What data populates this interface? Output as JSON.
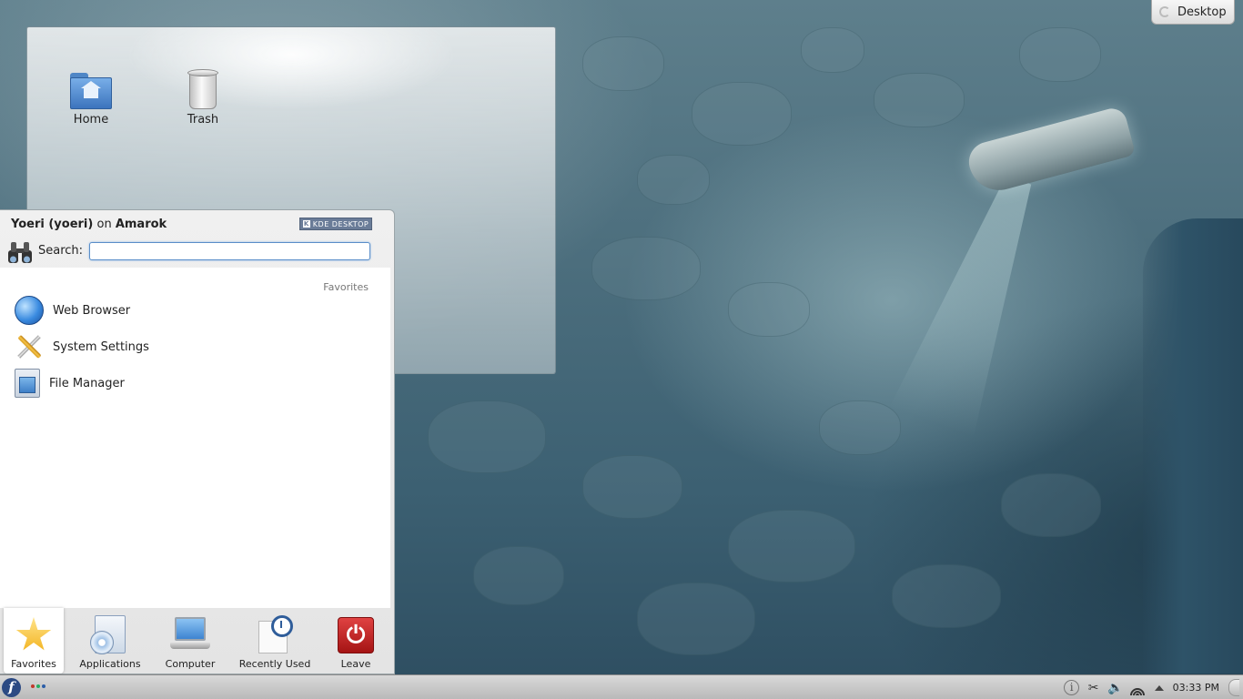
{
  "toolbox": {
    "label": "Desktop"
  },
  "desktop_icons": [
    {
      "label": "Home"
    },
    {
      "label": "Trash"
    }
  ],
  "kickoff": {
    "user": "Yoeri (yoeri)",
    "on": "on",
    "host": "Amarok",
    "badge": "KDE DESKTOP",
    "search_label": "Search:",
    "search_value": "",
    "section_title": "Favorites",
    "favorites": [
      {
        "label": "Web Browser",
        "icon": "globe-icon"
      },
      {
        "label": "System Settings",
        "icon": "tools-icon"
      },
      {
        "label": "File Manager",
        "icon": "file-manager-icon"
      }
    ],
    "tabs": [
      {
        "label": "Favorites",
        "icon": "star-icon",
        "active": true
      },
      {
        "label": "Applications",
        "icon": "applications-icon"
      },
      {
        "label": "Computer",
        "icon": "computer-icon"
      },
      {
        "label": "Recently Used",
        "icon": "recently-used-icon"
      },
      {
        "label": "Leave",
        "icon": "power-icon"
      }
    ]
  },
  "panel": {
    "launcher_icon": "fedora-icon",
    "pager_colors": [
      "#c0392b",
      "#27ae60",
      "#2c5ea8"
    ],
    "clock": "03:33 PM",
    "tray_icons": [
      "info-icon",
      "klipper-icon",
      "volume-icon",
      "wifi-icon",
      "expand-tray-icon"
    ]
  },
  "colors": {
    "accent": "#5a8ec9",
    "leave_red": "#c62828"
  }
}
